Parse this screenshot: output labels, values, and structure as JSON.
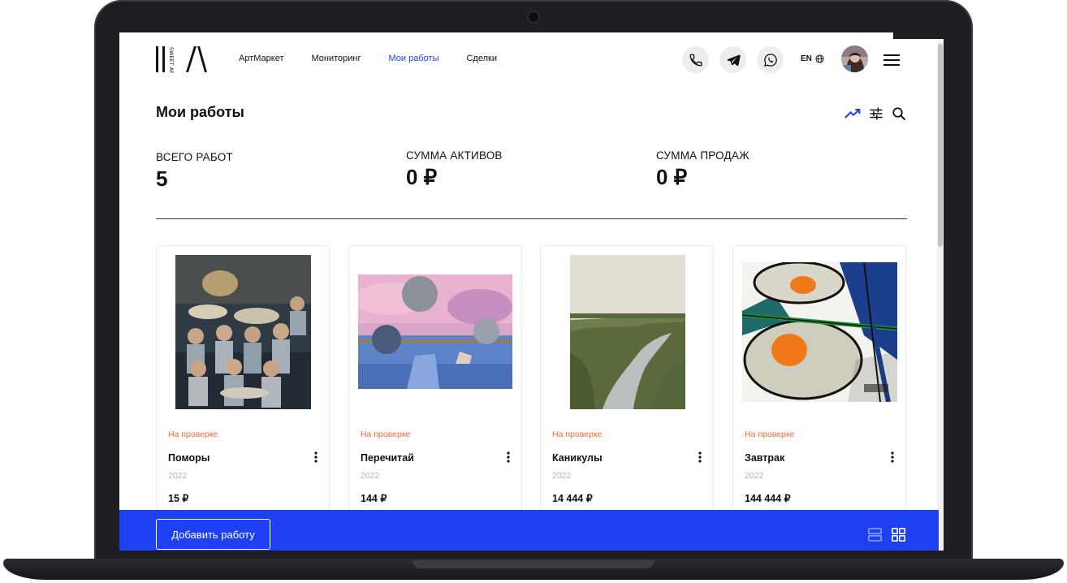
{
  "nav": {
    "items": [
      {
        "label": "АртМаркет",
        "active": false
      },
      {
        "label": "Мониторинг",
        "active": false
      },
      {
        "label": "Мои работы",
        "active": true
      },
      {
        "label": "Сделки",
        "active": false
      }
    ]
  },
  "header": {
    "logo_text": "SWEET ART",
    "lang": "EN",
    "icons": [
      "phone-icon",
      "telegram-icon",
      "whatsapp-icon",
      "globe-icon",
      "menu-icon"
    ]
  },
  "page": {
    "title": "Мои работы",
    "tool_icons": [
      "trending-icon",
      "filter-icon",
      "search-icon"
    ]
  },
  "stats": [
    {
      "label": "ВСЕГО РАБОТ",
      "value": "5"
    },
    {
      "label": "СУММА АКТИВОВ",
      "value": "0 ₽"
    },
    {
      "label": "СУММА ПРОДАЖ",
      "value": "0 ₽"
    }
  ],
  "works": [
    {
      "status": "На проверке",
      "title": "Поморы",
      "year": "2022",
      "price": "15 ₽"
    },
    {
      "status": "На проверке",
      "title": "Перечитай",
      "year": "2022",
      "price": "144 ₽"
    },
    {
      "status": "На проверке",
      "title": "Каникулы",
      "year": "2022",
      "price": "14 444 ₽"
    },
    {
      "status": "На проверке",
      "title": "Завтрак",
      "year": "2022",
      "price": "144 444 ₽"
    }
  ],
  "footer": {
    "add_label": "Добавить работу"
  },
  "colors": {
    "accent": "#1c40f2",
    "status": "#ef6a3d",
    "frame": "#1d1e22"
  }
}
